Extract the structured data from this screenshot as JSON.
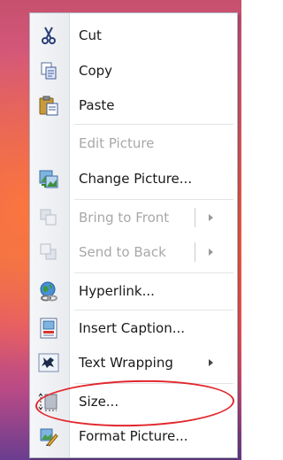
{
  "menu": {
    "items": [
      {
        "label": "Cut",
        "icon": "scissors-icon",
        "enabled": true
      },
      {
        "label": "Copy",
        "icon": "copy-icon",
        "enabled": true
      },
      {
        "label": "Paste",
        "icon": "paste-icon",
        "enabled": true
      },
      {
        "label": "Edit Picture",
        "icon": "",
        "enabled": false
      },
      {
        "label": "Change Picture...",
        "icon": "change-picture-icon",
        "enabled": true
      },
      {
        "label": "Bring to Front",
        "icon": "bring-to-front-icon",
        "enabled": false,
        "submenu": true
      },
      {
        "label": "Send to Back",
        "icon": "send-to-back-icon",
        "enabled": false,
        "submenu": true
      },
      {
        "label": "Hyperlink...",
        "icon": "hyperlink-globe-icon",
        "enabled": true
      },
      {
        "label": "Insert Caption...",
        "icon": "insert-caption-icon",
        "enabled": true
      },
      {
        "label": "Text Wrapping",
        "icon": "text-wrapping-icon",
        "enabled": true,
        "submenu": true
      },
      {
        "label": "Size...",
        "icon": "size-icon",
        "enabled": true
      },
      {
        "label": "Format Picture...",
        "icon": "format-picture-icon",
        "enabled": true
      }
    ]
  },
  "annotation": {
    "color": "#e2262c"
  }
}
